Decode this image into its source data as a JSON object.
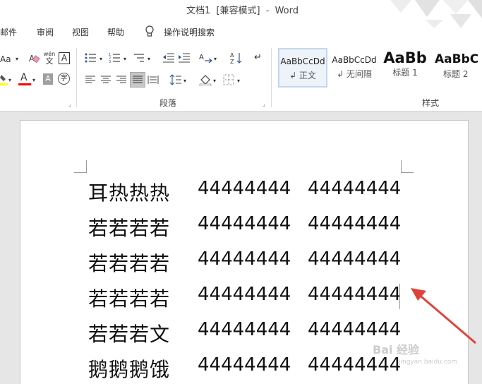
{
  "window": {
    "doc_name": "文档1",
    "mode": "[兼容模式]",
    "separator": "-",
    "app": "Word"
  },
  "menu": {
    "items": [
      "邮件",
      "审阅",
      "视图",
      "帮助"
    ],
    "tell_me": "操作说明搜索"
  },
  "ribbon": {
    "font_group": {
      "change_case": "Aa",
      "phonetic_top": "wén",
      "phonetic_bottom": "文",
      "char_border": "A",
      "font_color": "A",
      "char_shading": "A",
      "enclose": "字"
    },
    "paragraph_group": {
      "label": "段落"
    },
    "styles_group": {
      "label": "样式",
      "styles": [
        {
          "sample": "AaBbCcDd",
          "name": "↲ 正文",
          "active": true
        },
        {
          "sample": "AaBbCcDd",
          "name": "↲ 无间隔",
          "active": false
        },
        {
          "sample": "AaBb",
          "name": "标题 1",
          "active": false
        },
        {
          "sample": "AaBbC",
          "name": "标题 2",
          "active": false
        }
      ]
    }
  },
  "document": {
    "rows": [
      {
        "text": "耳热热热",
        "col2": "44444444",
        "col3": "44444444"
      },
      {
        "text": "若若若若",
        "col2": "44444444",
        "col3": "44444444"
      },
      {
        "text": "若若若若",
        "col2": "44444444",
        "col3": "44444444"
      },
      {
        "text": "若若若若",
        "col2": "44444444",
        "col3": "44444444"
      },
      {
        "text": "若若若文",
        "col2": "44444444",
        "col3": "44444444"
      },
      {
        "text": "鹅鹅鹅饿",
        "col2": "44444444",
        "col3": "44444444"
      }
    ]
  },
  "watermark": {
    "main": "Bai 经验",
    "sub": "jingyan.baidu.com"
  },
  "colors": {
    "font_color_bar": "#ff0000",
    "highlight_bar": "#ffff00",
    "arrow": "#e0433a",
    "active_style_border": "#c5d6ec"
  }
}
